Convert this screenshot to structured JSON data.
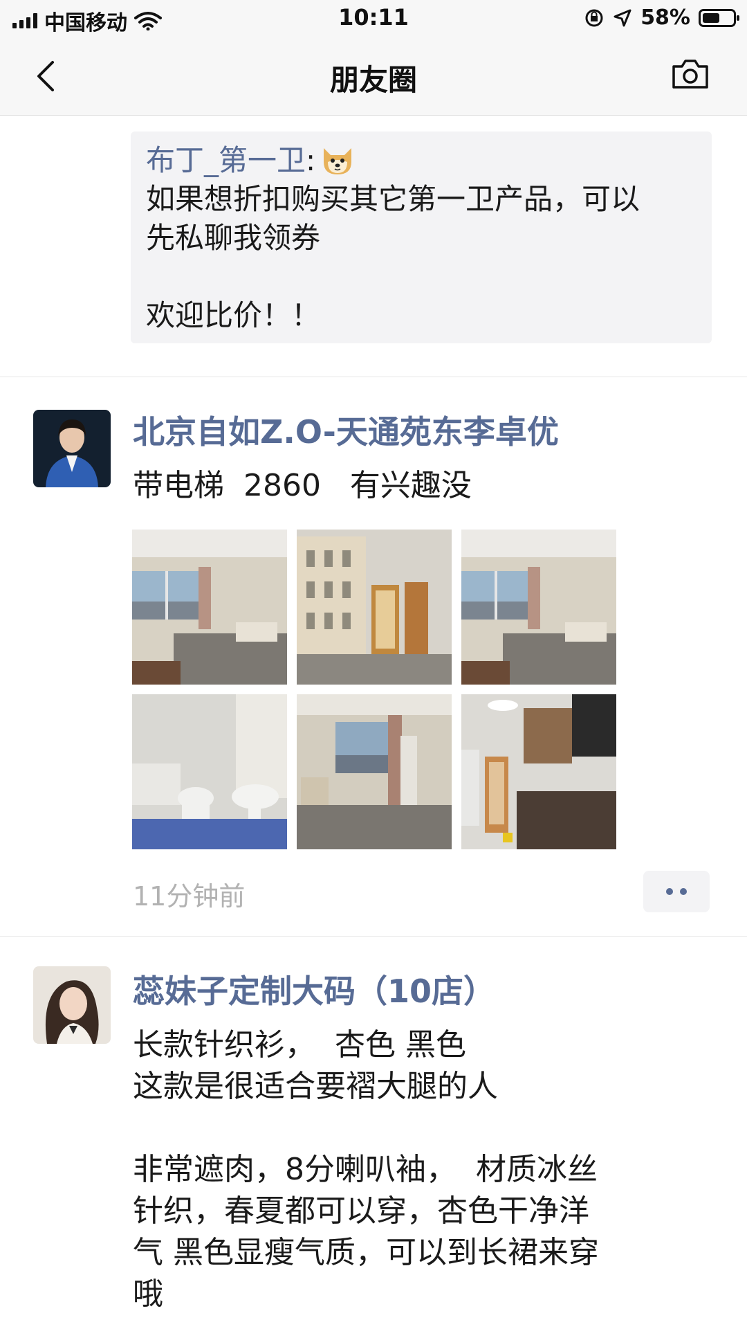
{
  "status_bar": {
    "carrier": "中国移动",
    "time": "10:11",
    "battery_percent_label": "58%",
    "battery_level": 0.58
  },
  "nav": {
    "title": "朋友圈",
    "back_icon": "chevron-left-icon",
    "camera_icon": "camera-icon"
  },
  "comment": {
    "author": "布丁_第一卫",
    "colon": ":",
    "emoji": "doge-emoji",
    "text": "如果想折扣购买其它第一卫产品，可以\n先私聊我领券\n\n欢迎比价！！"
  },
  "posts": [
    {
      "author": "北京自如Z.O-天通苑东李卓优",
      "text": "带电梯  2860   有兴趣没",
      "photos": [
        "bedroom-photo",
        "wardrobe-photo",
        "bedroom-photo",
        "bathroom-photo",
        "room-window-photo",
        "kitchen-photo"
      ],
      "time": "11分钟前"
    },
    {
      "author": "蕊妹子定制大码（10店）",
      "text": "长款针织衫，  杏色 黑色\n这款是很适合要褶大腿的人\n\n非常遮肉，8分喇叭袖，  材质冰丝\n针织，春夏都可以穿，杏色干净洋\n气 黑色显瘦气质，可以到长裙来穿\n哦"
    }
  ],
  "colors": {
    "link_name": "#576b95",
    "timestamp": "#b2b2b2",
    "comment_bg": "#f3f3f5",
    "nav_bg": "#f7f7f7"
  }
}
